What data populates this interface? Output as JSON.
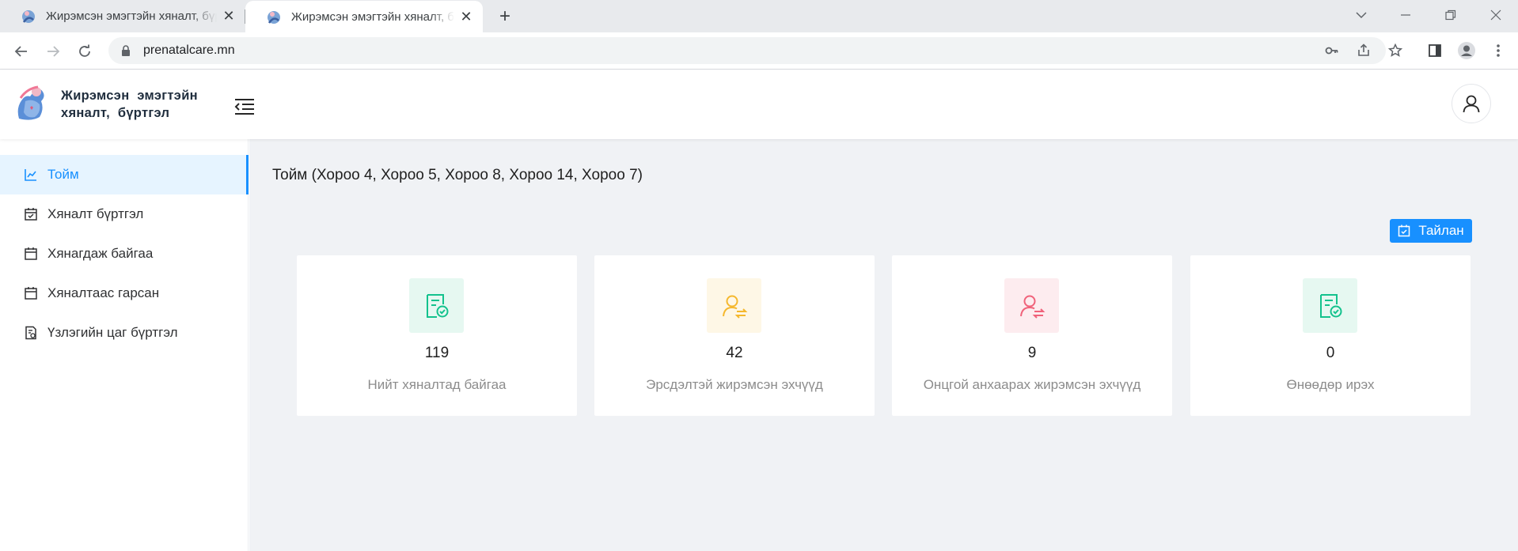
{
  "browser": {
    "tabs": [
      {
        "title": "Жирэмсэн эмэгтэйн хяналт, бүртгэл"
      },
      {
        "title": "Жирэмсэн эмэгтэйн хяналт, бүртгэл"
      }
    ],
    "url": "prenatalcare.mn"
  },
  "header": {
    "app_title": "Жирэмсэн эмэгтэйн хяналт, бүртгэл"
  },
  "sidebar": {
    "items": [
      {
        "label": "Тойм",
        "icon": "chart-icon"
      },
      {
        "label": "Хяналт бүртгэл",
        "icon": "calendar-check-icon"
      },
      {
        "label": "Хянагдаж байгаа",
        "icon": "calendar-icon"
      },
      {
        "label": "Хяналтаас гарсан",
        "icon": "calendar-icon"
      },
      {
        "label": "Үзлэгийн цаг бүртгэл",
        "icon": "document-clock-icon"
      }
    ]
  },
  "main": {
    "title": "Тойм (Хороо 4, Хороо 5, Хороо 8, Хороо 14, Хороо 7)",
    "report_button": "Тайлан",
    "cards": [
      {
        "value": "119",
        "label": "Нийт хяналтад байгаа",
        "icon": "document-check-icon",
        "color": "#13c28d",
        "bg": "#e6f8f1"
      },
      {
        "value": "42",
        "label": "Эрсдэлтэй жирэмсэн эхчүүд",
        "icon": "user-swap-icon",
        "color": "#f5b82e",
        "bg": "#fef7e6"
      },
      {
        "value": "9",
        "label": "Онцгой анхаарах жирэмсэн эхчүүд",
        "icon": "user-swap-icon",
        "color": "#f0627a",
        "bg": "#fdecef"
      },
      {
        "value": "0",
        "label": "Өнөөдөр ирэх",
        "icon": "document-check-icon",
        "color": "#13c28d",
        "bg": "#e6f8f1"
      }
    ]
  },
  "colors": {
    "accent": "#1890ff",
    "active_bg": "#e6f4ff",
    "main_bg": "#f0f2f5"
  }
}
